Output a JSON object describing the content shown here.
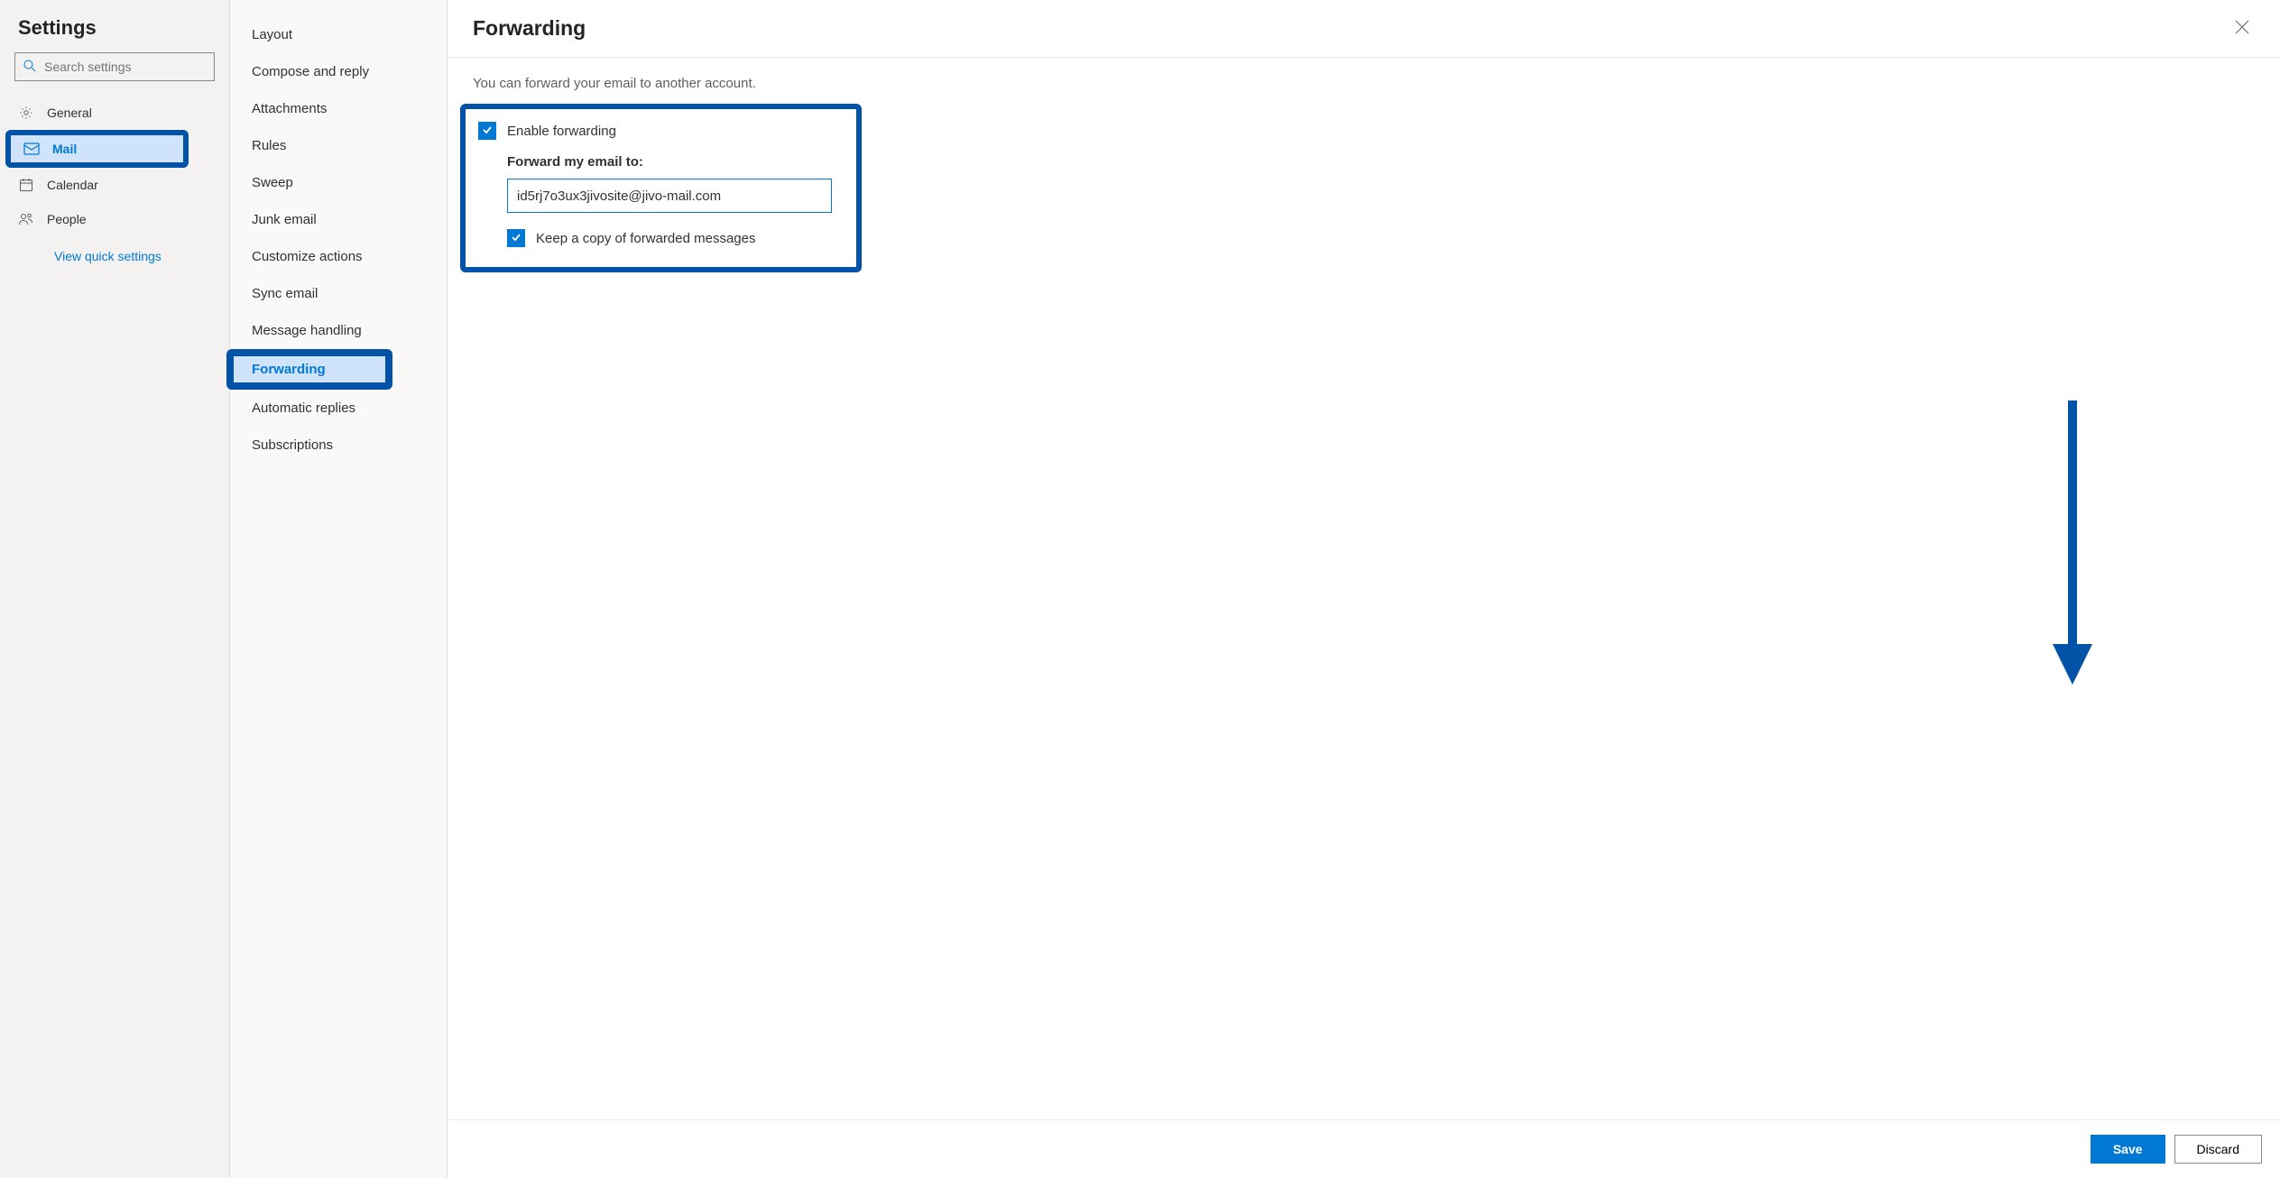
{
  "header": {
    "title": "Settings"
  },
  "search": {
    "placeholder": "Search settings"
  },
  "categories": {
    "general": "General",
    "mail": "Mail",
    "calendar": "Calendar",
    "people": "People",
    "quick_settings": "View quick settings"
  },
  "sub_items": {
    "layout": "Layout",
    "compose": "Compose and reply",
    "attachments": "Attachments",
    "rules": "Rules",
    "sweep": "Sweep",
    "junk": "Junk email",
    "customize": "Customize actions",
    "sync": "Sync email",
    "message_handling": "Message handling",
    "forwarding": "Forwarding",
    "automatic_replies": "Automatic replies",
    "subscriptions": "Subscriptions"
  },
  "main": {
    "title": "Forwarding",
    "intro": "You can forward your email to another account.",
    "enable_label": "Enable forwarding",
    "forward_to_label": "Forward my email to:",
    "forward_to_value": "id5rj7o3ux3jivosite@jivo-mail.com",
    "keep_copy_label": "Keep a copy of forwarded messages"
  },
  "footer": {
    "save": "Save",
    "discard": "Discard"
  },
  "colors": {
    "accent": "#0078d4",
    "highlight_border": "#0053a6"
  }
}
